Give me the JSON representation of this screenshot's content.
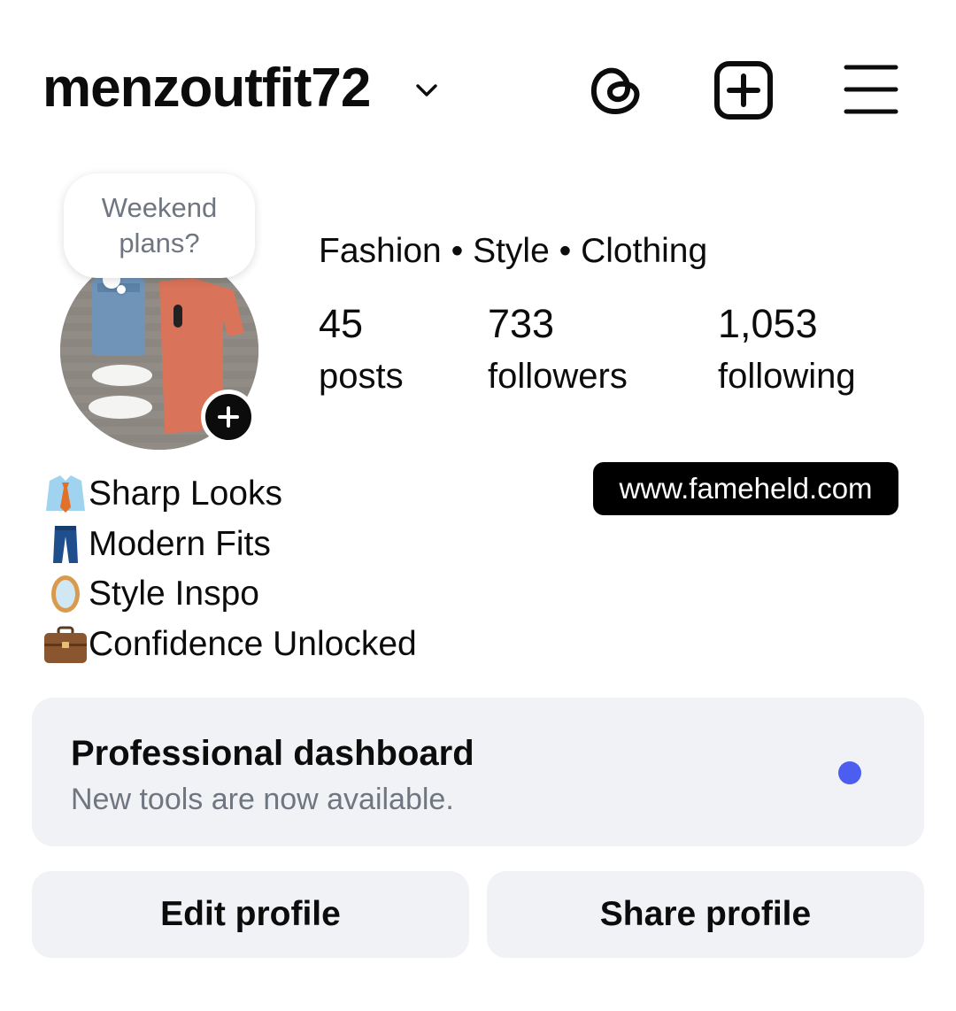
{
  "header": {
    "username": "menzoutfit72",
    "icons": [
      "chevron-down-icon",
      "threads-icon",
      "create-icon",
      "menu-icon"
    ]
  },
  "note": {
    "line1": "Weekend",
    "line2": "plans?"
  },
  "profile": {
    "category": "Fashion • Style • Clothing",
    "stats": [
      {
        "value": "45",
        "label": "posts"
      },
      {
        "value": "733",
        "label": "followers"
      },
      {
        "value": "1,053",
        "label": "following"
      }
    ]
  },
  "bio": [
    {
      "emoji": "shirt-tie-emoji",
      "text": "Sharp Looks"
    },
    {
      "emoji": "jeans-emoji",
      "text": "Modern Fits"
    },
    {
      "emoji": "mirror-emoji",
      "text": "Style Inspo"
    },
    {
      "emoji": "briefcase-emoji",
      "text": "Confidence Unlocked"
    }
  ],
  "link": "www.fameheld.com",
  "dashboard": {
    "title": "Professional dashboard",
    "subtitle": "New tools are now available.",
    "dot_color": "#4c5ef0"
  },
  "buttons": {
    "edit": "Edit profile",
    "share": "Share profile"
  }
}
